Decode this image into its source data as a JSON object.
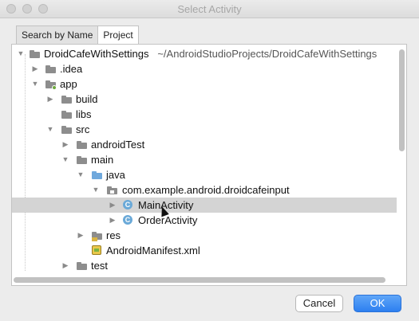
{
  "window": {
    "title": "Select Activity"
  },
  "tabs": [
    {
      "label": "Search by Name"
    },
    {
      "label": "Project"
    }
  ],
  "tree": {
    "root_label": "DroidCafeWithSettings",
    "root_path": "~/AndroidStudioProjects/DroidCafeWithSettings",
    "items": [
      {
        "label": "DroidCafeWithSettings",
        "icon": "project-folder-icon",
        "expanded": true
      },
      {
        "label": ".idea",
        "icon": "folder-icon",
        "expanded": false
      },
      {
        "label": "app",
        "icon": "module-folder-icon",
        "expanded": true
      },
      {
        "label": "build",
        "icon": "folder-icon",
        "expanded": false
      },
      {
        "label": "libs",
        "icon": "folder-icon"
      },
      {
        "label": "src",
        "icon": "folder-icon",
        "expanded": true
      },
      {
        "label": "androidTest",
        "icon": "folder-icon",
        "expanded": false
      },
      {
        "label": "main",
        "icon": "folder-icon",
        "expanded": true
      },
      {
        "label": "java",
        "icon": "source-folder-icon",
        "expanded": true
      },
      {
        "label": "com.example.android.droidcafeinput",
        "icon": "package-icon",
        "expanded": true
      },
      {
        "label": "MainActivity",
        "icon": "class-icon",
        "expanded": false,
        "selected": true
      },
      {
        "label": "OrderActivity",
        "icon": "class-icon",
        "expanded": false
      },
      {
        "label": "res",
        "icon": "resource-folder-icon",
        "expanded": false
      },
      {
        "label": "AndroidManifest.xml",
        "icon": "manifest-icon"
      },
      {
        "label": "test",
        "icon": "folder-icon",
        "expanded": false
      }
    ]
  },
  "buttons": {
    "cancel": "Cancel",
    "ok": "OK"
  },
  "colors": {
    "accent": "#2d7ff0",
    "selection": "#d4d4d4",
    "folder": "#8d8d8d",
    "class_icon": "#6aa9d8"
  }
}
